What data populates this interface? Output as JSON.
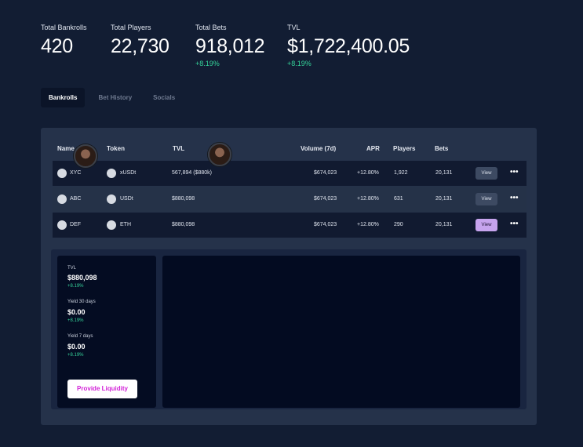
{
  "stats": [
    {
      "label": "Total Bankrolls",
      "value": "420",
      "delta": ""
    },
    {
      "label": "Total Players",
      "value": "22,730",
      "delta": ""
    },
    {
      "label": "Total Bets",
      "value": "918,012",
      "delta": "+8.19%"
    },
    {
      "label": "TVL",
      "value": "$1,722,400.05",
      "delta": "+8.19%"
    }
  ],
  "tabs": [
    {
      "label": "Bankrolls",
      "active": true
    },
    {
      "label": "Bet History",
      "active": false
    },
    {
      "label": "Socials",
      "active": false
    }
  ],
  "table": {
    "headers": {
      "name": "Name",
      "token": "Token",
      "tvl": "TVL",
      "volume": "Volume (7d)",
      "apr": "APR",
      "players": "Players",
      "bets": "Bets"
    },
    "rows": [
      {
        "name": "XYC",
        "token": "xUSDt",
        "tvl": "567,894 ($880k)",
        "volume": "$674,023",
        "apr": "+12.80%",
        "players": "1,922",
        "bets": "20,131",
        "action": "View",
        "more": "•••"
      },
      {
        "name": "ABC",
        "token": "USDt",
        "tvl": "$880,098",
        "volume": "$674,023",
        "apr": "+12.80%",
        "players": "631",
        "bets": "20,131",
        "action": "View",
        "more": "•••"
      },
      {
        "name": "DEF",
        "token": "ETH",
        "tvl": "$880,098",
        "volume": "$674,023",
        "apr": "+12.80%",
        "players": "290",
        "bets": "20,131",
        "action": "View",
        "more": "•••"
      }
    ]
  },
  "detail": {
    "tvl_label": "TVL",
    "tvl_value": "$880,098",
    "tvl_delta": "+8.19%",
    "yield30_label": "Yield 30 days",
    "yield30_value": "$0.00",
    "yield30_delta": "+8.19%",
    "yield7_label": "Yield 7 days",
    "yield7_value": "$0.00",
    "yield7_delta": "+8.19%",
    "provide_label": "Provide Liquidity"
  },
  "colors": {
    "background": "#121d33",
    "panel": "#25324a",
    "positive": "#35d39a",
    "view_active": "#c7a4ee",
    "liquidity_text": "#d21fd7"
  }
}
